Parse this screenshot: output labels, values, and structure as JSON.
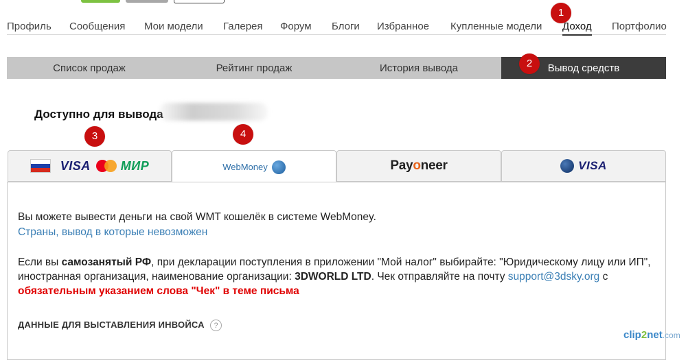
{
  "nav": {
    "items": [
      {
        "label": "Профиль"
      },
      {
        "label": "Сообщения"
      },
      {
        "label": "Мои модели"
      },
      {
        "label": "Галерея"
      },
      {
        "label": "Форум"
      },
      {
        "label": "Блоги"
      },
      {
        "label": "Избранное"
      },
      {
        "label": "Купленные модели"
      },
      {
        "label": "Доход"
      },
      {
        "label": "Портфолио"
      }
    ],
    "active": "Доход"
  },
  "subtabs": {
    "items": [
      {
        "label": "Список продаж"
      },
      {
        "label": "Рейтинг продаж"
      },
      {
        "label": "История вывода"
      },
      {
        "label": "Вывод средств"
      }
    ],
    "active": "Вывод средств"
  },
  "badges": [
    "1",
    "2",
    "3",
    "4"
  ],
  "available_label": "Доступно для вывода",
  "payment_tabs": {
    "card": {
      "visa": "VISA",
      "mir": "МИР",
      "icons": [
        "russia-flag-icon",
        "mastercard-icon"
      ]
    },
    "webmoney": {
      "label": "WebMoney",
      "icon": "webmoney-globe-icon"
    },
    "payoneer": {
      "label_a": "Pay",
      "label_o": "o",
      "label_b": "neer"
    },
    "visa_intl": {
      "label": "VISA",
      "icon": "globe-icon"
    }
  },
  "content": {
    "line1": "Вы можете вывести деньги на свой WMT кошелёк в системе WebMoney.",
    "countries_link": "Страны, вывод в которые невозможен",
    "p3_a": "Если вы ",
    "p3_bold1": "самозанятый РФ",
    "p3_b": ", при декларации поступления в приложении \"Мой налог\" выбирайте: \"Юридическому лицу или ИП\", иностранная организация, наименование организации: ",
    "p3_bold2": "3DWORLD LTD",
    "p3_c": ". Чек отправляйте на почту ",
    "p3_email": "support@3dsky.org",
    "p3_d": " с ",
    "p3_red": "обязательным указанием слова \"Чек\" в теме письма",
    "invoice_heading": "ДАННЫЕ ДЛЯ ВЫСТАВЛЕНИЯ ИНВОЙСА",
    "help_symbol": "?"
  },
  "watermark": {
    "a": "clip",
    "b": "2",
    "c": "net",
    "d": ".com"
  },
  "colors": {
    "accent_red": "#c80f0f",
    "link": "#3b7fb5",
    "active_tab": "#3c3c3c",
    "subtab_bg": "#c6c6c6"
  }
}
